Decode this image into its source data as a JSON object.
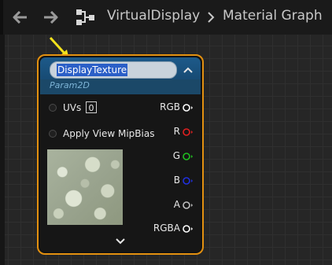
{
  "toolbar": {
    "back_icon": "back-arrow-icon",
    "forward_icon": "forward-arrow-icon",
    "graph_icon": "graph-hierarchy-icon",
    "breadcrumb": [
      "VirtualDisplay",
      "Material Graph"
    ]
  },
  "node": {
    "title": "DisplayTexture",
    "subtitle": "Param2D",
    "accent_color": "#e3900f",
    "header_color": "#1d5a8a",
    "inputs": [
      {
        "label": "UVs",
        "value": "0"
      },
      {
        "label": "Apply View MipBias"
      }
    ],
    "outputs": [
      {
        "label": "RGB",
        "color": "#ffffff"
      },
      {
        "label": "R",
        "color": "#e02020"
      },
      {
        "label": "G",
        "color": "#20c020"
      },
      {
        "label": "B",
        "color": "#2030e0"
      },
      {
        "label": "A",
        "color": "#c0c0c0"
      },
      {
        "label": "RGBA",
        "color": "#ffffff"
      }
    ]
  },
  "annotation": {
    "arrow_color": "#f2e21c"
  }
}
